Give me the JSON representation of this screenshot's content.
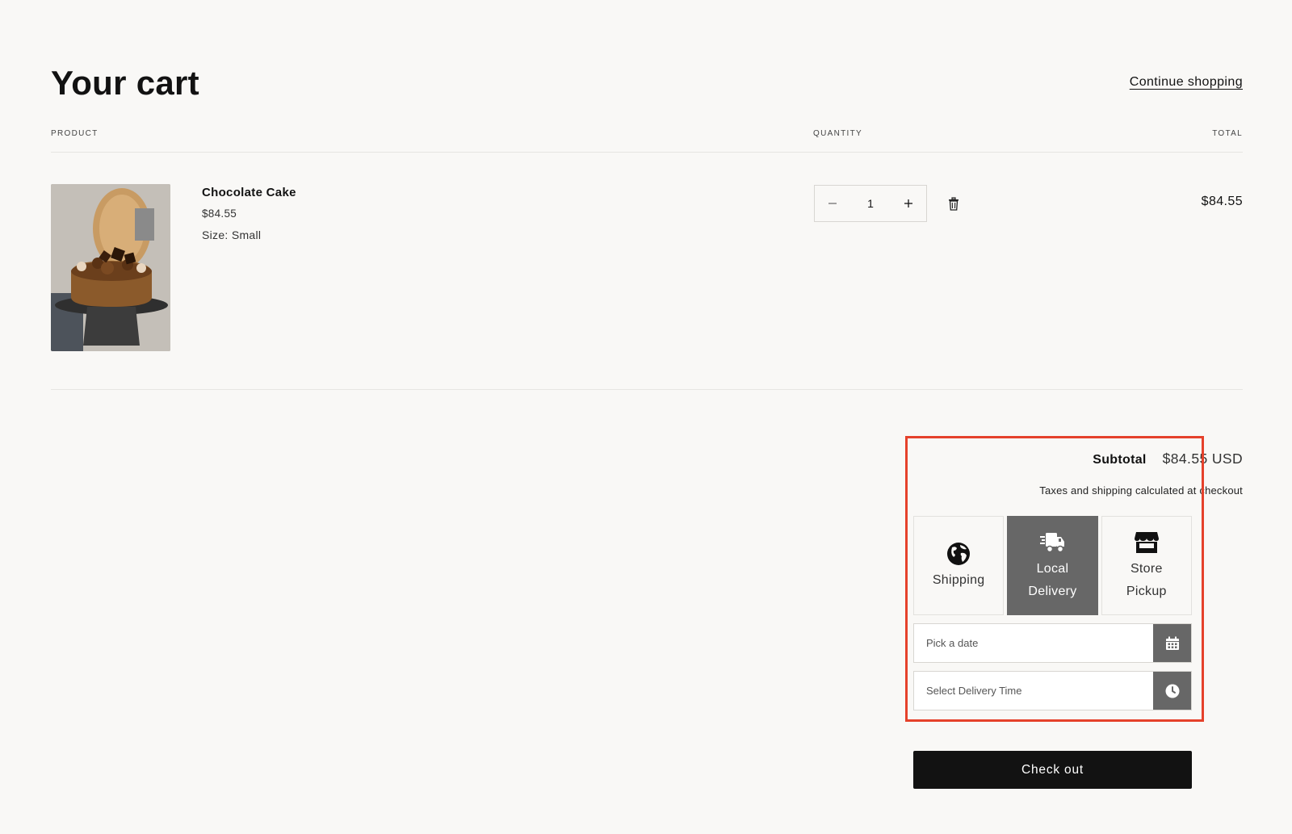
{
  "header": {
    "title": "Your cart",
    "continue_link": "Continue shopping"
  },
  "columns": {
    "product": "PRODUCT",
    "quantity": "QUANTITY",
    "total": "TOTAL"
  },
  "item": {
    "name": "Chocolate Cake",
    "price": "$84.55",
    "size": "Size: Small",
    "quantity": "1",
    "line_total": "$84.55",
    "image_icon": "chocolate-cake-photo",
    "decrease_icon": "minus-icon",
    "increase_icon": "plus-icon",
    "remove_icon": "trash-icon"
  },
  "summary": {
    "subtotal_label": "Subtotal",
    "subtotal_value": "$84.55 USD",
    "tax_note": "Taxes and shipping calculated at checkout",
    "frame_color": "#e5412b"
  },
  "delivery_methods": [
    {
      "label": "Shipping",
      "icon": "globe-icon",
      "active": false
    },
    {
      "label": "Local\nDelivery",
      "icon": "delivery-truck-icon",
      "active": true
    },
    {
      "label": "Store\nPickup",
      "icon": "storefront-icon",
      "active": false
    }
  ],
  "delivery_fields": {
    "date_placeholder": "Pick a date",
    "date_icon": "calendar-icon",
    "time_placeholder": "Select Delivery Time",
    "time_icon": "clock-icon"
  },
  "checkout": {
    "label": "Check out"
  },
  "colors": {
    "background": "#f9f8f6",
    "active_method": "#676767",
    "checkout_button": "#121212"
  }
}
